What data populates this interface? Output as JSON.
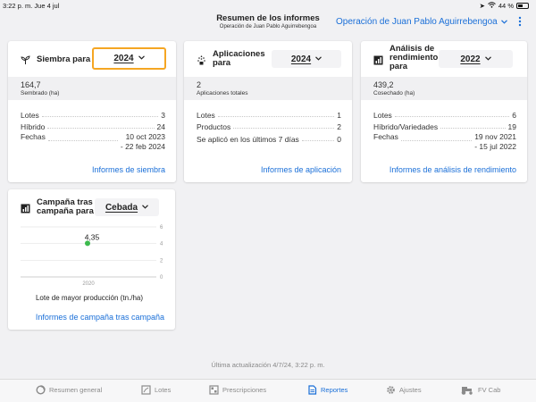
{
  "status_bar": {
    "time_date": "3:22 p. m.   Jue 4 jul",
    "battery": "44 %"
  },
  "header": {
    "title": "Resumen de los informes",
    "subtitle": "Operación de Juan Pablo Aguirrebengoa",
    "operation_selector": "Operación de Juan Pablo Aguirrebengoa"
  },
  "cards": {
    "siembra": {
      "label": "Siembra para",
      "year": "2024",
      "metric_value": "164,7",
      "metric_unit": "Sembrado (ha)",
      "rows": [
        {
          "label": "Lotes",
          "value": "3"
        },
        {
          "label": "Híbrido",
          "value": "24"
        },
        {
          "label": "Fechas",
          "value_line1": "10 oct 2023",
          "value_line2": "- 22 feb 2024"
        }
      ],
      "link": "Informes de siembra"
    },
    "aplicaciones": {
      "label_line1": "Aplicaciones",
      "label_line2": "para",
      "year": "2024",
      "metric_value": "2",
      "metric_unit": "Aplicaciones totales",
      "rows": [
        {
          "label": "Lotes",
          "value": "1"
        },
        {
          "label": "Productos",
          "value": "2"
        },
        {
          "label": "Se aplicó en los últimos 7 días",
          "value": "0"
        }
      ],
      "link": "Informes de aplicación"
    },
    "rendimiento": {
      "label_line1": "Análisis de",
      "label_line2": "rendimiento",
      "label_line3": "para",
      "year": "2022",
      "metric_value": "439,2",
      "metric_unit": "Cosechado (ha)",
      "rows": [
        {
          "label": "Lotes",
          "value": "6"
        },
        {
          "label": "Híbrido/Variedades",
          "value": "19"
        },
        {
          "label": "Fechas",
          "value_line1": "19 nov 2021",
          "value_line2": "- 15 jul 2022"
        }
      ],
      "link": "Informes de análisis de rendimiento"
    },
    "campana": {
      "label_line1": "Campaña tras",
      "label_line2": "campaña para",
      "crop": "Cebada",
      "link": "Informes de campaña tras campaña"
    }
  },
  "chart_data": {
    "type": "scatter",
    "x": [
      "2020"
    ],
    "values": [
      4.35
    ],
    "data_labels": [
      "4,35"
    ],
    "xlabel": "Lote de mayor producción (tn./ha)",
    "ylabel": "",
    "ylim": [
      0,
      6
    ],
    "yticks": [
      "0",
      "2",
      "4",
      "6"
    ],
    "grid": true,
    "point_color": "#3dba4e"
  },
  "footer": {
    "last_update": "Última actualización 4/7/24, 3:22 p. m."
  },
  "tabs": [
    {
      "label": "Resumen general",
      "icon": "summary-icon",
      "active": false
    },
    {
      "label": "Lotes",
      "icon": "fields-icon",
      "active": false
    },
    {
      "label": "Prescripciones",
      "icon": "prescriptions-icon",
      "active": false
    },
    {
      "label": "Reportes",
      "icon": "reports-icon",
      "active": true
    },
    {
      "label": "Ajustes",
      "icon": "gear-icon",
      "active": false
    },
    {
      "label": "FV Cab",
      "icon": "tractor-icon",
      "active": false
    }
  ],
  "colors": {
    "accent": "#1a6fd8",
    "highlight": "#f5a623",
    "point": "#3dba4e"
  }
}
